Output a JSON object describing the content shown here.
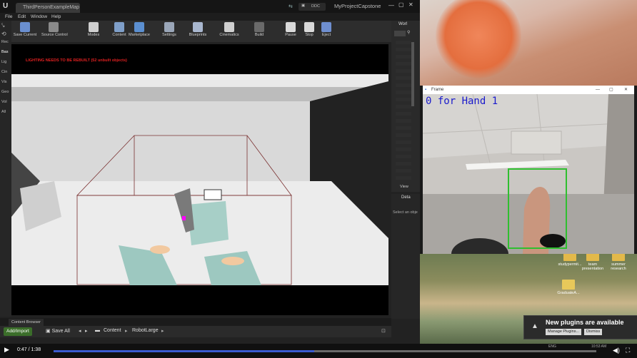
{
  "editor": {
    "tab_title": "ThirdPersonExampleMap",
    "project_name": "MyProjectCapstone",
    "ddc_label": "DDC",
    "logo": "U",
    "menu": [
      "File",
      "Edit",
      "Window",
      "Help"
    ],
    "toolbar": [
      {
        "label": "Save Current",
        "icon": "save-icon",
        "color": "#6a8fd0"
      },
      {
        "label": "Source Control",
        "icon": "source-control-icon",
        "color": "#8a8a8a"
      },
      {
        "label": "Modes",
        "icon": "modes-icon",
        "color": "#cfcfcf"
      },
      {
        "label": "Content",
        "icon": "content-icon",
        "color": "#7f9fc9"
      },
      {
        "label": "Marketplace",
        "icon": "marketplace-icon",
        "color": "#5b8fd0"
      },
      {
        "label": "Settings",
        "icon": "settings-icon",
        "color": "#9aa6b8"
      },
      {
        "label": "Blueprints",
        "icon": "blueprints-icon",
        "color": "#a9b7cf"
      },
      {
        "label": "Cinematics",
        "icon": "cinematics-icon",
        "color": "#d0d0d0"
      },
      {
        "label": "Build",
        "icon": "build-icon",
        "color": "#6a6a6a"
      },
      {
        "label": "Pause",
        "icon": "pause-icon",
        "color": "#dadada"
      },
      {
        "label": "Stop",
        "icon": "stop-icon",
        "color": "#dadada"
      },
      {
        "label": "Eject",
        "icon": "eject-icon",
        "color": "#6f8fd0"
      }
    ],
    "left_tabs": [
      "Rec",
      "Bas",
      "Lig",
      "Cin",
      "Vis",
      "Geo",
      "Vol",
      "All"
    ],
    "lighting_warning": "LIGHTING NEEDS TO BE REBUILT (52 unbuilt objects)",
    "world_panel_title": "Worl",
    "view_options": "View",
    "details_title": "Deta",
    "details_hint": "Select an obje",
    "content_browser_tab": "Content Browser",
    "add_import": "Add/Import",
    "save_all": "Save All",
    "breadcrumb": [
      "Content",
      "RobotLarge"
    ]
  },
  "frame_window": {
    "title": "Frame",
    "overlay_text": "0 for Hand 1",
    "box_color": "#2fbf2f"
  },
  "desktop": {
    "icons": [
      {
        "label": "studypermit..."
      },
      {
        "label": "team presentation"
      },
      {
        "label": "summer research"
      },
      {
        "label": "GraduateA..."
      }
    ]
  },
  "notification": {
    "title": "New plugins are available",
    "manage": "Manage Plugins...",
    "dismiss": "Dismiss"
  },
  "video": {
    "time": "0:47 / 1:38",
    "progress": 0.48,
    "tray_lang": "ENG",
    "tray_time": "10:53 AM"
  }
}
